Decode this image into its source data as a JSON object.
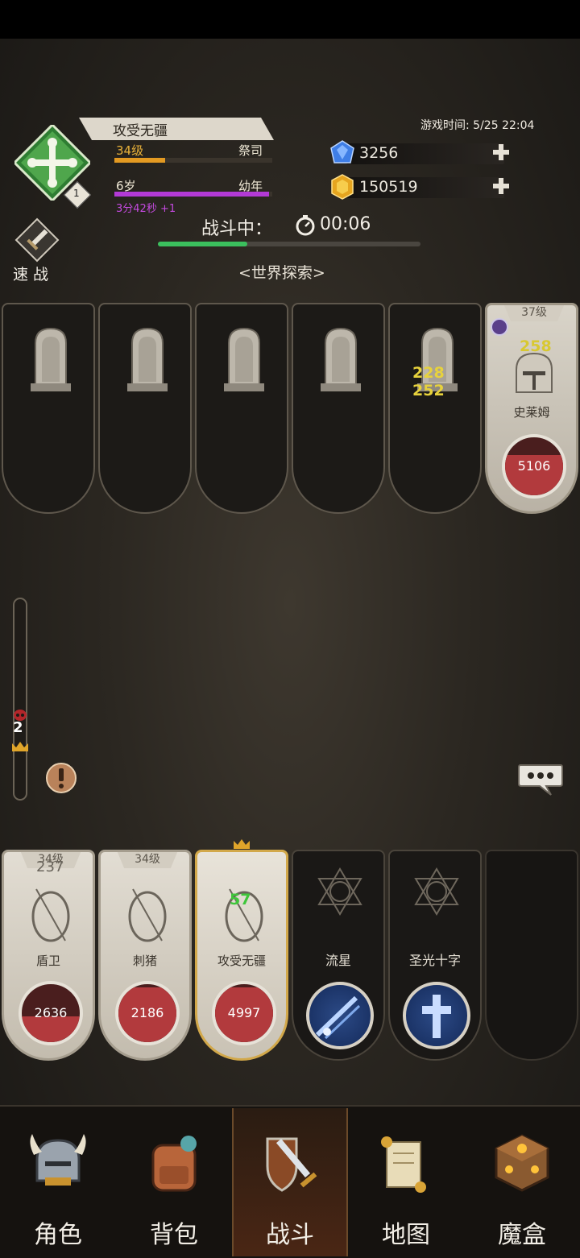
{
  "header": {
    "player_name": "攻受无疆",
    "level_label": "34级",
    "class_label": "祭司",
    "age_label": "6岁",
    "stage_label": "幼年",
    "age_timer": "3分42秒 +1",
    "emblem_level": "1",
    "game_time": "游戏时间: 5/25 22:04",
    "xp_progress": 0.32,
    "age_progress": 0.98
  },
  "currency": {
    "gems": "3256",
    "gold": "150519"
  },
  "battle": {
    "status_label": "战斗中：",
    "timer": "00:06",
    "progress": 0.34,
    "quick_battle": "速 战",
    "area": "<世界探索>"
  },
  "enemies": [
    {
      "state": "dead"
    },
    {
      "state": "dead"
    },
    {
      "state": "dead"
    },
    {
      "state": "dead"
    },
    {
      "state": "dead",
      "damage": [
        "228",
        "252"
      ]
    },
    {
      "state": "alive",
      "level": "37级",
      "name": "史莱姆",
      "hp": "5106",
      "damage": "258",
      "hp_ratio": 0.7
    }
  ],
  "gauge": {
    "value": "2"
  },
  "party": [
    {
      "level": "34级",
      "name": "盾卫",
      "hp": "2636",
      "floating": "237",
      "hp_ratio": 0.45
    },
    {
      "level": "34级",
      "name": "刺猪",
      "hp": "2186",
      "hp_ratio": 0.95
    },
    {
      "name": "攻受无疆",
      "hp": "4997",
      "heal": "57",
      "hp_ratio": 0.95
    },
    {
      "skill": "流星"
    },
    {
      "skill": "圣光十字"
    },
    {}
  ],
  "nav": [
    {
      "label": "角色",
      "icon": "helmet-icon"
    },
    {
      "label": "背包",
      "icon": "backpack-icon"
    },
    {
      "label": "战斗",
      "icon": "sword-shield-icon",
      "active": true
    },
    {
      "label": "地图",
      "icon": "scroll-map-icon"
    },
    {
      "label": "魔盒",
      "icon": "magic-box-icon"
    }
  ],
  "colors": {
    "accent_gold": "#e39a22",
    "age_purple": "#b33ad6",
    "progress_green": "#3bbf5d",
    "hp_red": "#b23a3d",
    "damage_yellow": "#e7d23c",
    "heal_green": "#3ec63a"
  }
}
